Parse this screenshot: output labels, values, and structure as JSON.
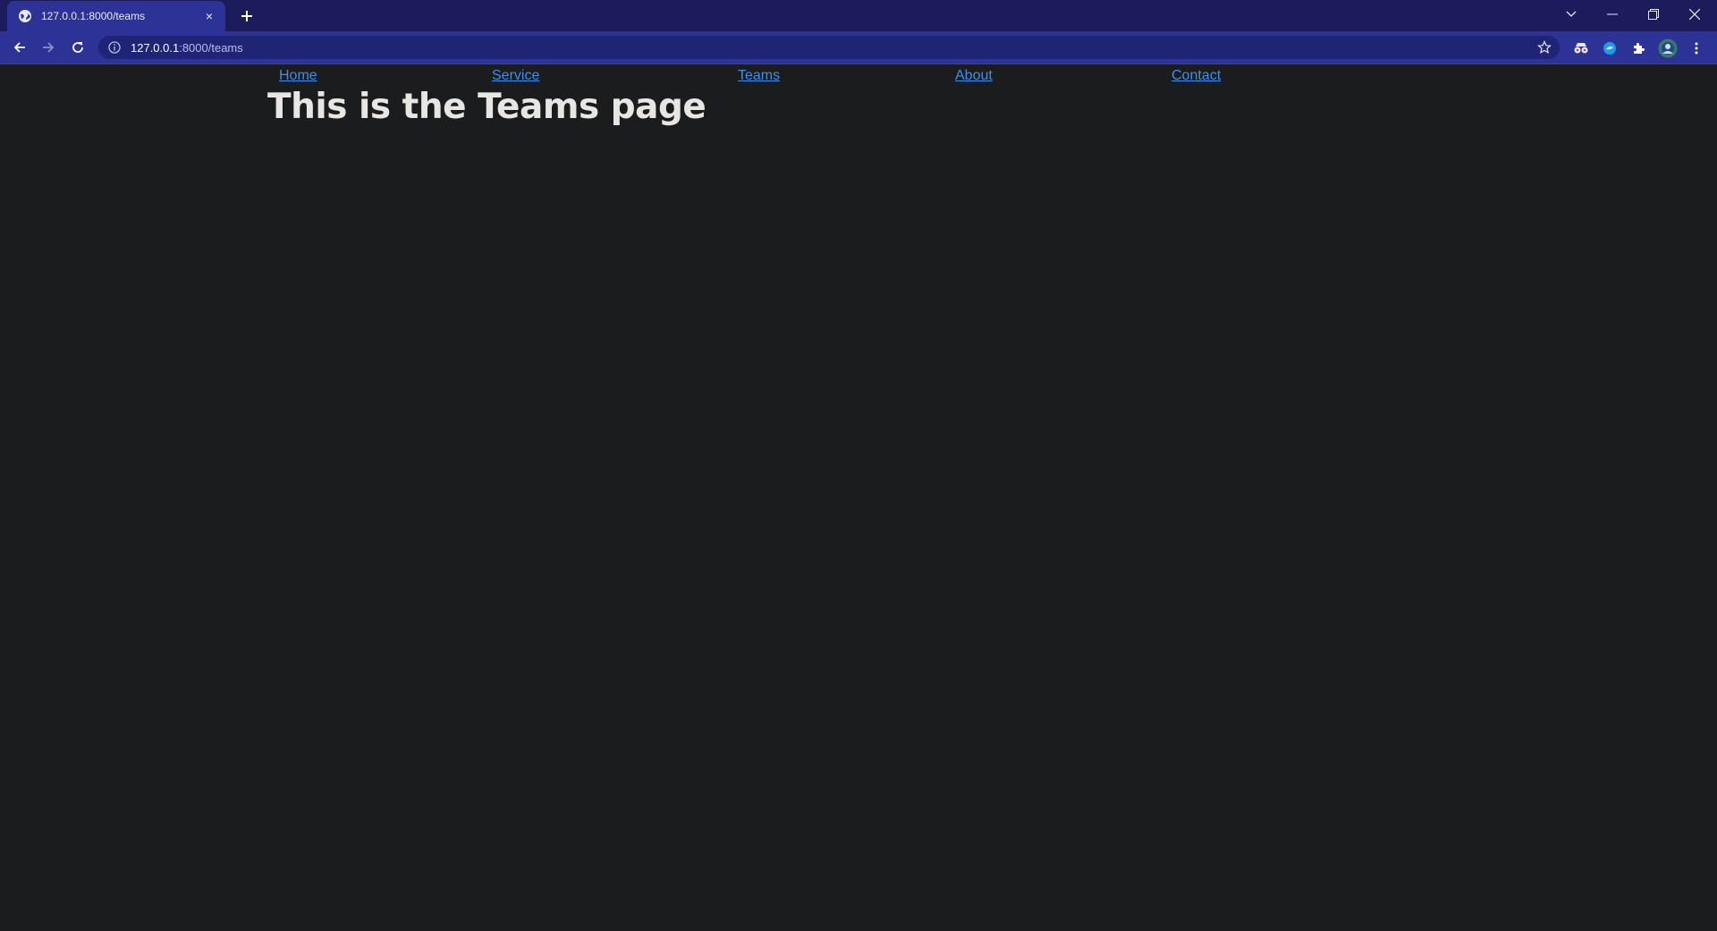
{
  "browser": {
    "tab": {
      "title": "127.0.0.1:8000/teams",
      "favicon": "globe-icon",
      "close": "×"
    },
    "new_tab": "+",
    "address_bar": {
      "host": "127.0.0.1",
      "path": ":8000/teams"
    },
    "window_controls": [
      "tab-search-icon",
      "minimize-icon",
      "restore-icon",
      "close-icon"
    ],
    "extensions": [
      "incognito-glasses-icon",
      "extension-blue-icon",
      "puzzle-icon",
      "profile-avatar",
      "menu-dots-icon"
    ],
    "colors": {
      "tabstrip": "#1c1b5c",
      "toolbar": "#2c3296",
      "omnibox": "#202474"
    }
  },
  "page": {
    "nav": {
      "home": "Home",
      "service": "Service",
      "teams": "Teams",
      "about": "About",
      "contact": "Contact"
    },
    "heading": "This is the Teams page",
    "colors": {
      "background": "#1b1c1e",
      "link": "#3d8ef0",
      "heading": "#e8e6e3"
    }
  }
}
